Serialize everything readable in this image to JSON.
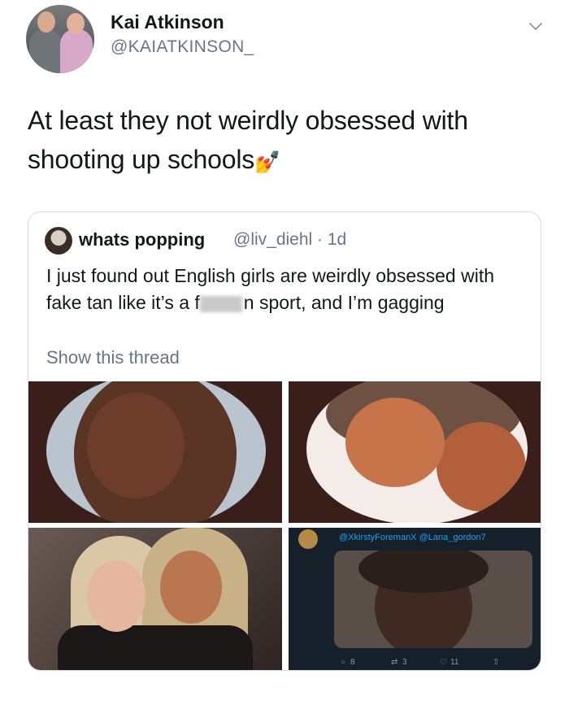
{
  "tweet": {
    "display_name": "Kai Atkinson",
    "handle": "@KAIATKINSON_",
    "text_line1": "At least they not weirdly obsessed with",
    "text_line2": "shooting up schools",
    "emoji": "💅"
  },
  "quote": {
    "display_name": "whats popping",
    "meta": "@liv_diehl · 1d",
    "text_part1": "I just found out English girls are weirdly obsessed with fake tan like it’s a f",
    "text_part2": "n sport, and I’m gagging",
    "show_thread": "Show this thread",
    "embedded_tweet": {
      "mentions": "@XkirstyForemanX @Lana_gordon7",
      "replies": "8",
      "retweets": "3",
      "likes": "11"
    }
  },
  "icons": [
    "chevron-down-icon",
    "reply-icon",
    "retweet-icon",
    "like-icon",
    "share-icon"
  ],
  "colors": {
    "text": "#14171a",
    "secondary": "#657786",
    "link": "#1da1f2",
    "border": "#d5dbe0"
  }
}
